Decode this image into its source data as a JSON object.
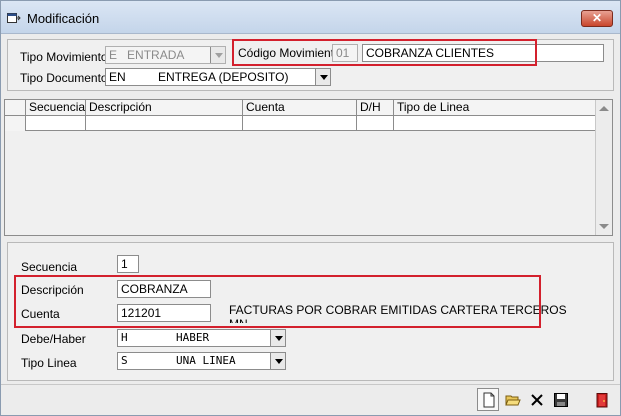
{
  "window": {
    "title": "Modificación",
    "close_label": "✕"
  },
  "header_form": {
    "tipo_movimiento": {
      "label": "Tipo Movimiento",
      "code": "E",
      "value": "ENTRADA"
    },
    "codigo_movimiento": {
      "label": "Código Movimiento",
      "code": "01",
      "value": "COBRANZA CLIENTES"
    },
    "tipo_documento": {
      "label": "Tipo Documento",
      "code": "EN",
      "value": "ENTREGA (DEPOSITO)"
    }
  },
  "grid": {
    "columns": [
      "Secuencia",
      "Descripción",
      "Cuenta",
      "D/H",
      "Tipo de Linea"
    ],
    "rows": []
  },
  "detail_form": {
    "secuencia": {
      "label": "Secuencia",
      "value": "1"
    },
    "descripcion": {
      "label": "Descripción",
      "value": "COBRANZA"
    },
    "cuenta": {
      "label": "Cuenta",
      "value": "121201",
      "description": "FACTURAS POR COBRAR EMITIDAS CARTERA TERCEROS",
      "description_overflow": "MN"
    },
    "debe_haber": {
      "label": "Debe/Haber",
      "code": "H",
      "value": "HABER"
    },
    "tipo_linea": {
      "label": "Tipo Linea",
      "code": "S",
      "value": "UNA LINEA"
    }
  },
  "toolbar": {
    "buttons": [
      "new-icon",
      "open-folder-icon",
      "delete-icon",
      "save-icon",
      "exit-door-icon"
    ]
  },
  "colors": {
    "highlight": "#d3202d",
    "title_gradient_top": "#dbe6f4",
    "close_button": "#c9462c"
  }
}
